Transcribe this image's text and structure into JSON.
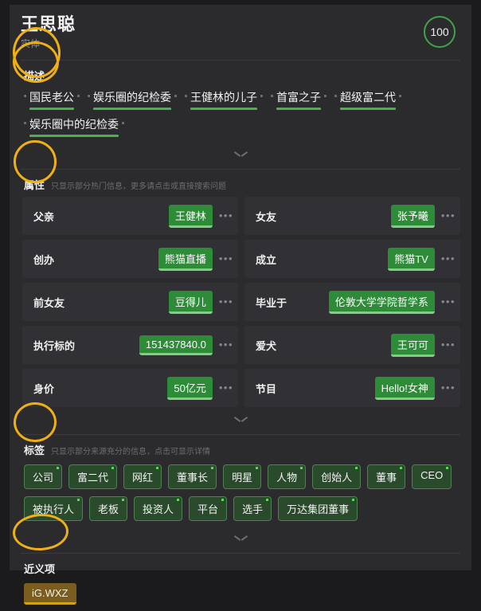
{
  "header": {
    "entity_name": "王思聪",
    "entity_type": "实体",
    "score": "100"
  },
  "sections": {
    "description": {
      "title": "描述",
      "note": "",
      "items": [
        "国民老公",
        "娱乐圈的纪检委",
        "王健林的儿子",
        "首富之子",
        "超级富二代",
        "娱乐圈中的纪检委"
      ],
      "expand_icon": "chevron-down-icon"
    },
    "attributes": {
      "title": "属性",
      "note": "只显示部分热门信息，更多请点击或直接搜索问题",
      "more_glyph": "•••",
      "rows": [
        {
          "key": "父亲",
          "value": "王健林"
        },
        {
          "key": "女友",
          "value": "张予曦"
        },
        {
          "key": "创办",
          "value": "熊猫直播"
        },
        {
          "key": "成立",
          "value": "熊猫TV"
        },
        {
          "key": "前女友",
          "value": "豆得儿"
        },
        {
          "key": "毕业于",
          "value": "伦敦大学学院哲学系"
        },
        {
          "key": "执行标的",
          "value": "151437840.0"
        },
        {
          "key": "爱犬",
          "value": "王可可"
        },
        {
          "key": "身价",
          "value": "50亿元"
        },
        {
          "key": "节目",
          "value": "Hello!女神"
        }
      ],
      "expand_icon": "chevron-down-icon"
    },
    "tags": {
      "title": "标签",
      "note": "只显示部分来源充分的信息，点击可显示详情",
      "items": [
        "公司",
        "富二代",
        "网红",
        "董事长",
        "明星",
        "人物",
        "创始人",
        "董事",
        "CEO",
        "被执行人",
        "老板",
        "投资人",
        "平台",
        "选手",
        "万达集团董事"
      ],
      "expand_icon": "chevron-down-icon"
    },
    "synonyms": {
      "title": "近义项",
      "items": [
        "iG.WXZ"
      ]
    }
  },
  "annotations": {
    "color": "#efb013",
    "circles": [
      "entity-type-circle",
      "description-title-circle",
      "attributes-title-circle",
      "tags-title-circle",
      "synonyms-title-circle"
    ]
  },
  "colors": {
    "accent_green": "#4caf50",
    "value_green": "#2e8b37",
    "tag_green": "#2a4a2c",
    "synonym_gold": "#d4a017",
    "panel_bg": "#2b2b2e",
    "page_bg": "#1b1b1d"
  }
}
